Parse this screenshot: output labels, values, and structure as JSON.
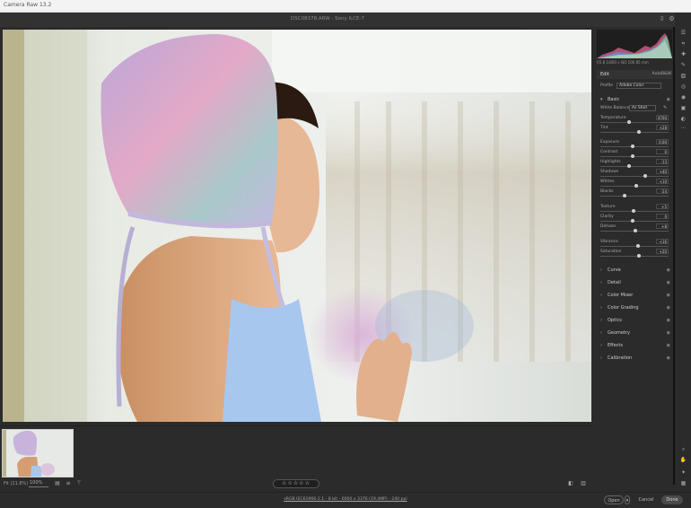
{
  "window": {
    "title": "Camera Raw 13.2"
  },
  "header": {
    "file_title": "DSC08378.ARW  -  Sony ILCE-7"
  },
  "filmstrip": {
    "fit_label": "Fit (21.8%)",
    "zoom_value": "100%"
  },
  "rating": {
    "stars": "☆☆☆☆☆"
  },
  "footer": {
    "workflow_link": "sRGB IEC61966-2.1 - 8 bit - 6000 x 3376 (19.4MP) - 240 ppi",
    "open_label": "Open",
    "cancel_label": "Cancel",
    "done_label": "Done"
  },
  "histogram": {
    "info": "f/2.8   1/800 s   ISO 100   85 mm"
  },
  "edit": {
    "title": "Edit",
    "auto": "Auto",
    "bw": "B&W"
  },
  "profile": {
    "label": "Profile",
    "value": "Adobe Color"
  },
  "basic": {
    "title": "Basic",
    "white_balance_label": "White Balance",
    "white_balance_value": "As Shot"
  },
  "sliders": [
    {
      "label": "Temperature",
      "value": "4700",
      "position": 0.45
    },
    {
      "label": "Tint",
      "value": "+28",
      "position": 0.6
    },
    {
      "label": "Exposure",
      "value": "0.00",
      "position": 0.5
    },
    {
      "label": "Contrast",
      "value": "0",
      "position": 0.5
    },
    {
      "label": "Highlights",
      "value": "-13",
      "position": 0.44
    },
    {
      "label": "Shadows",
      "value": "+40",
      "position": 0.7
    },
    {
      "label": "Whites",
      "value": "+10",
      "position": 0.55
    },
    {
      "label": "Blacks",
      "value": "-24",
      "position": 0.38
    },
    {
      "label": "Texture",
      "value": "+5",
      "position": 0.52
    },
    {
      "label": "Clarity",
      "value": "0",
      "position": 0.5
    },
    {
      "label": "Dehaze",
      "value": "+8",
      "position": 0.54
    },
    {
      "label": "Vibrance",
      "value": "+16",
      "position": 0.58
    },
    {
      "label": "Saturation",
      "value": "+20",
      "position": 0.6
    }
  ],
  "sections": [
    {
      "name": "Curve"
    },
    {
      "name": "Detail"
    },
    {
      "name": "Color Mixer"
    },
    {
      "name": "Color Grading"
    },
    {
      "name": "Optics"
    },
    {
      "name": "Geometry"
    },
    {
      "name": "Effects"
    },
    {
      "name": "Calibration"
    }
  ],
  "colors": {
    "panel_bg": "#2b2b2b",
    "done_button": "#4a4a4a",
    "accent_blue": "#3c8ee0"
  }
}
